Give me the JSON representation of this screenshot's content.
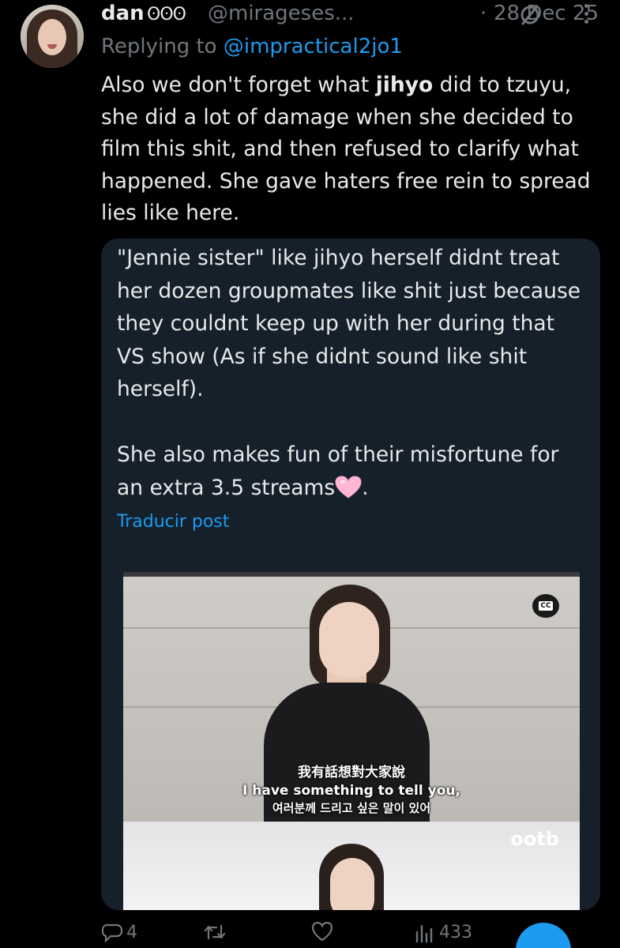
{
  "tweet": {
    "display_name": "dan",
    "badges": "ʘʘʘ",
    "handle": "@mirageses...",
    "separator": "·",
    "date": "28 Dec 25",
    "replying_prefix": "Replying to",
    "replying_to": "@impractical2jo1",
    "text_before": "Also we don't forget what ",
    "text_bold": "jihyo",
    "text_after": " did to tzuyu, she did a lot of damage when she decided to film this shit, and then refused to clarify what happened. She gave haters free rein to spread lies like here."
  },
  "quote": {
    "text_main": "\"Jennie sister\" like jihyo herself didnt treat her dozen groupmates like shit just because they couldnt keep up with her during that VS show (As if she didnt sound like shit herself).\n\nShe also makes fun of their misfortune for an extra 3.5 streams",
    "text_end": ".",
    "translate_label": "Traducir post",
    "video": {
      "caption_chinese": "我有話想對大家說",
      "caption_english": "I have something to tell you,",
      "caption_korean": "여러분께 드리고 싶은 말이 있어",
      "watermark": "ootb",
      "cc_label": "CC"
    }
  },
  "actions": {
    "reply_count": "4",
    "retweet_count": "",
    "like_count": "",
    "views_count": "433"
  },
  "icons": {
    "grok": "grok-slash-icon",
    "more": "more-vertical-icon",
    "reply": "reply-bubble-icon",
    "retweet": "retweet-icon",
    "like": "heart-outline-icon",
    "views": "bar-chart-icon",
    "share": "share-icon",
    "emoji": "pink-heart-emoji"
  },
  "colors": {
    "background": "#000000",
    "quote_bg": "#15202b",
    "accent": "#1d9bf0",
    "muted": "#71767b",
    "text": "#e7e9ea"
  }
}
